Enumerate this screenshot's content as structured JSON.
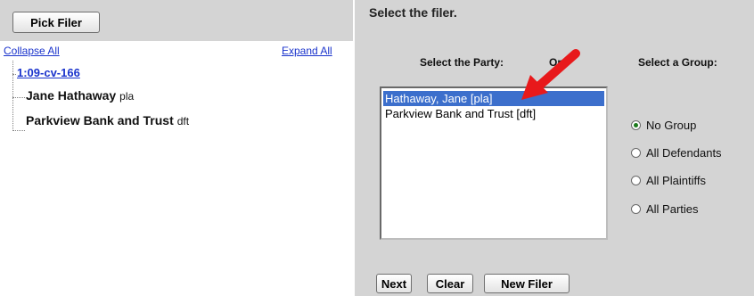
{
  "left": {
    "pick_filer": "Pick Filer",
    "collapse_all": "Collapse All",
    "expand_all": "Expand All",
    "case_number": "1:09-cv-166",
    "parties": [
      {
        "name": "Jane Hathaway",
        "role": "pla"
      },
      {
        "name": "Parkview Bank and Trust",
        "role": "dft"
      }
    ]
  },
  "right": {
    "header": "Select the filer.",
    "party_label": "Select the Party:",
    "or_label": "Or",
    "group_label": "Select a Group:",
    "listbox_options": [
      "Hathaway, Jane  [pla]",
      "Parkview Bank and Trust  [dft]"
    ],
    "selected_option": "Hathaway, Jane  [pla]",
    "groups": [
      "No Group",
      "All Defendants",
      "All Plaintiffs",
      "All Parties"
    ],
    "selected_group": "No Group",
    "buttons": {
      "next": "Next",
      "clear": "Clear",
      "new_filer": "New Filer"
    }
  },
  "colors": {
    "link": "#1a33cc",
    "selection": "#3c6fcc",
    "arrow": "#e8191b",
    "radio_dot": "#1b7a1b"
  }
}
